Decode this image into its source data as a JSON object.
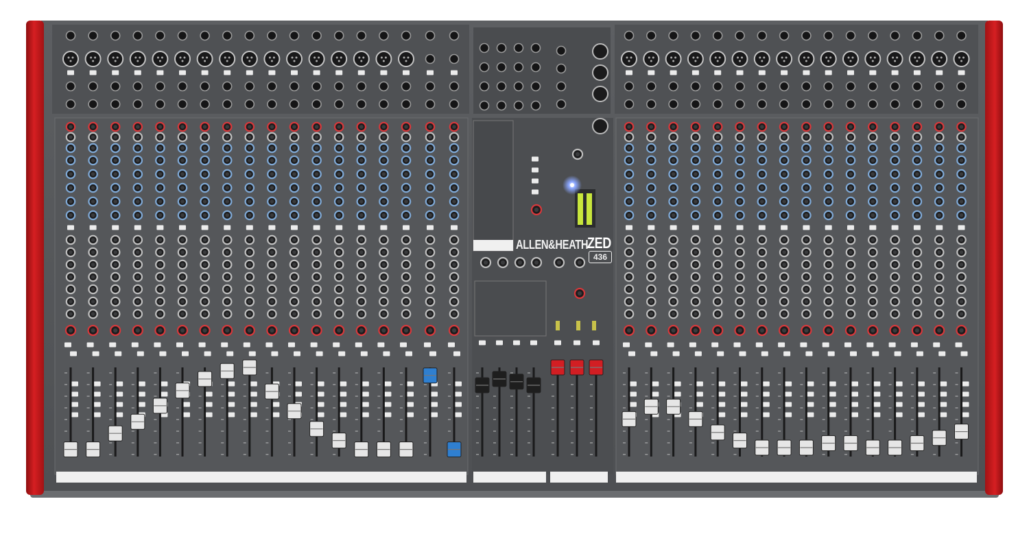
{
  "device": {
    "brand": "ALLEN&HEATH",
    "model": "ZED",
    "model_number": "436"
  },
  "colors": {
    "side_cheeks": "#c8191c",
    "panel": "#585a5d",
    "panel_dark": "#3d3f42",
    "fader_cap_channel": "#e6e6e6",
    "fader_cap_group": "#1e1e1e",
    "fader_cap_master": "#d21e23",
    "fader_cap_stereo": "#2f7fd0",
    "knob_red": "#d8383b",
    "knob_blue": "#7fa9d6",
    "meter_green": "#c8e63c",
    "led_blue": "#7d9bff"
  },
  "channel_strips": {
    "left_mono_count": 16,
    "left_stereo_count": 2,
    "right_mono_count": 16,
    "group_count": 4,
    "master_count": 3
  },
  "fader_levels": {
    "left_mono": [
      0.08,
      0.08,
      0.26,
      0.39,
      0.57,
      0.74,
      0.87,
      0.96,
      1.0,
      0.73,
      0.51,
      0.31,
      0.18,
      0.08,
      0.08,
      0.08
    ],
    "left_stereo": [
      0.91,
      0.08
    ],
    "groups": [
      0.8,
      0.87,
      0.84,
      0.8
    ],
    "masters": [
      1.0,
      1.0,
      1.0
    ],
    "right_mono": [
      0.42,
      0.56,
      0.56,
      0.42,
      0.27,
      0.18,
      0.1,
      0.1,
      0.1,
      0.15,
      0.15,
      0.1,
      0.1,
      0.15,
      0.21,
      0.28
    ]
  }
}
